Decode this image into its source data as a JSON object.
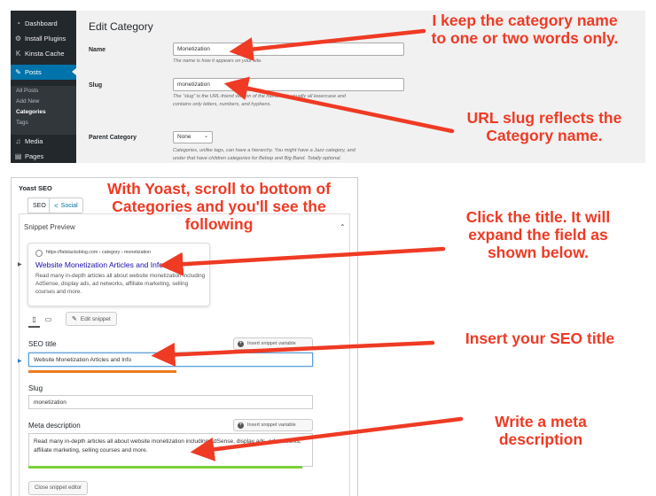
{
  "wp": {
    "sidebar": {
      "items": [
        {
          "icon": "gauge-icon",
          "glyph": "◔",
          "label": "Dashboard"
        },
        {
          "icon": "plug-icon",
          "glyph": "⚙",
          "label": "Install Plugins"
        },
        {
          "icon": "kinsta-icon",
          "glyph": "K",
          "label": "Kinsta Cache"
        },
        {
          "icon": "pin-icon",
          "glyph": "✎",
          "label": "Posts"
        },
        {
          "icon": "media-icon",
          "glyph": "♫",
          "label": "Media"
        },
        {
          "icon": "pages-icon",
          "glyph": "▤",
          "label": "Pages"
        }
      ],
      "subitems": [
        "All Posts",
        "Add New",
        "Categories",
        "Tags"
      ]
    },
    "title": "Edit Category",
    "name": {
      "label": "Name",
      "value": "Monetization",
      "help": "The name is how it appears on your site."
    },
    "slug": {
      "label": "Slug",
      "value": "monetization",
      "help_line1": "The “slug” is the URL-friend",
      "help_line1_tail": "version of the name. It is usually all lowercase and",
      "help_line2": "contains only letters, numbers, and hyphens."
    },
    "parent": {
      "label": "Parent Category",
      "value": "None",
      "help_line1": "Categories, unlike tags, can have a hierarchy. You might have a Jazz category, and",
      "help_line2": "under that have children categories for Bebop and Big Band. Totally optional."
    }
  },
  "yoast": {
    "header": "Yoast SEO",
    "tabs": {
      "seo": "SEO",
      "social": "Social"
    },
    "snippet_preview_label": "Snippet Preview",
    "preview": {
      "url": "https://fatstacksblog.com › category › monetization",
      "title": "Website Monetization Articles and Info",
      "description": "Read many in-depth articles all about website monetization including AdSense, display ads, ad networks, affiliate marketing, selling courses and more."
    },
    "edit_snippet": "Edit snippet",
    "seo_title_label": "SEO title",
    "insert_variable": "Insert snippet variable",
    "seo_title_value": "Website Monetization Articles and Info",
    "slug_label": "Slug",
    "slug_value": "monetization",
    "meta_label": "Meta description",
    "meta_value": "Read many in-depth articles all about website monetization including AdSense, display ads, ad networks, affiliate marketing, selling courses and more.",
    "close_editor": "Close snippet editor",
    "colors": {
      "title_progress": "#ee7c1b",
      "meta_progress": "#7ad03a"
    }
  },
  "annotations": {
    "keep_name": "I keep the category name to one or two words only.",
    "slug_reflects": "URL slug reflects the Category name.",
    "with_yoast": "With Yoast, scroll to bottom of Categories and you'll see the following",
    "click_title": "Click the title. It will expand the field as shown below.",
    "insert_title": "Insert your SEO title",
    "write_meta": "Write a meta description",
    "color": "#ef3a24"
  }
}
